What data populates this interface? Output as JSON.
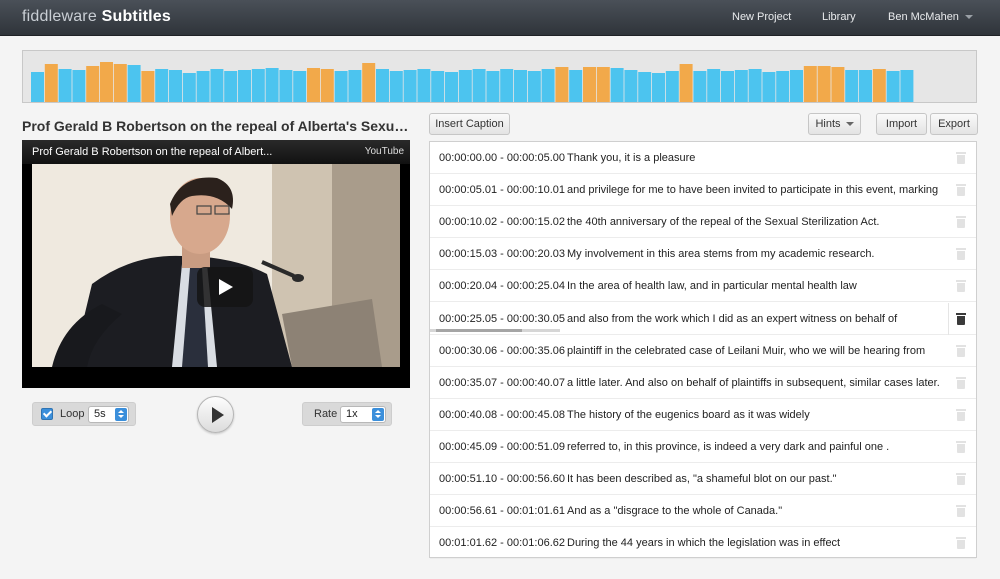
{
  "app": {
    "brand_prefix": "fiddleware",
    "brand_name": "Subtitles"
  },
  "nav": {
    "new_project": "New Project",
    "library": "Library",
    "user": "Ben McMahen"
  },
  "colors": {
    "wave_blue": "#4cc4ef",
    "wave_orange": "#f2a94a",
    "accent_blue": "#3b8fdb"
  },
  "waveform": {
    "active_segment_colors": [
      "blue",
      "orange",
      "blue",
      "blue",
      "orange",
      "orange",
      "orange",
      "blue",
      "orange",
      "blue",
      "blue",
      "blue",
      "blue",
      "blue",
      "blue",
      "blue",
      "blue",
      "blue",
      "blue",
      "blue",
      "orange",
      "orange",
      "blue",
      "blue",
      "orange",
      "blue",
      "blue",
      "blue",
      "blue",
      "blue",
      "blue",
      "blue",
      "blue",
      "blue",
      "blue",
      "blue",
      "blue",
      "blue",
      "orange",
      "blue",
      "orange",
      "orange",
      "blue",
      "blue",
      "blue",
      "blue",
      "blue",
      "orange",
      "blue",
      "blue",
      "blue",
      "blue",
      "blue",
      "blue",
      "blue",
      "blue",
      "orange",
      "orange",
      "orange",
      "blue",
      "blue",
      "orange",
      "blue",
      "blue"
    ]
  },
  "video": {
    "heading": "Prof Gerald B Robertson on the repeal of Alberta's Sexual Sterilizati...",
    "player_title": "Prof Gerald B Robertson on the repeal of Albert...",
    "provider": "YouTube"
  },
  "controls": {
    "loop_label": "Loop",
    "loop_checked": true,
    "loop_value": "5s",
    "rate_label": "Rate",
    "rate_value": "1x"
  },
  "toolbar": {
    "insert_caption": "Insert Caption",
    "hints": "Hints",
    "import": "Import",
    "export": "Export"
  },
  "captions": [
    {
      "time": "00:00:00.00 - 00:00:05.00",
      "text": "Thank you, it is a pleasure"
    },
    {
      "time": "00:00:05.01 - 00:00:10.01",
      "text": "and privilege for me to have been invited to participate in this event, marking"
    },
    {
      "time": "00:00:10.02 - 00:00:15.02",
      "text": "the 40th anniversary of the repeal of the Sexual Sterilization Act."
    },
    {
      "time": "00:00:15.03 - 00:00:20.03",
      "text": "My involvement in this area stems from my academic research."
    },
    {
      "time": "00:00:20.04 - 00:00:25.04",
      "text": "In the area of health law, and in particular mental health law"
    },
    {
      "time": "00:00:25.05 - 00:00:30.05",
      "text": "and also from the work which I did as an expert witness on behalf of",
      "active": true,
      "progress": 0.7
    },
    {
      "time": "00:00:30.06 - 00:00:35.06",
      "text": "plaintiff in the celebrated case of Leilani Muir, who we will be hearing from"
    },
    {
      "time": "00:00:35.07 - 00:00:40.07",
      "text": "a little later. And also on behalf of plaintiffs in subsequent, similar cases later."
    },
    {
      "time": "00:00:40.08 - 00:00:45.08",
      "text": "The history of the eugenics board as it was widely"
    },
    {
      "time": "00:00:45.09 - 00:00:51.09",
      "text": "referred to, in this province, is indeed a very dark and painful one ."
    },
    {
      "time": "00:00:51.10 - 00:00:56.60",
      "text": "It has been described as, \"a shameful blot on our past.\""
    },
    {
      "time": "00:00:56.61 - 00:01:01.61",
      "text": "And as a \"disgrace to the whole of Canada.\""
    },
    {
      "time": "00:01:01.62 - 00:01:06.62",
      "text": "During the 44 years in which the legislation was in effect"
    }
  ]
}
